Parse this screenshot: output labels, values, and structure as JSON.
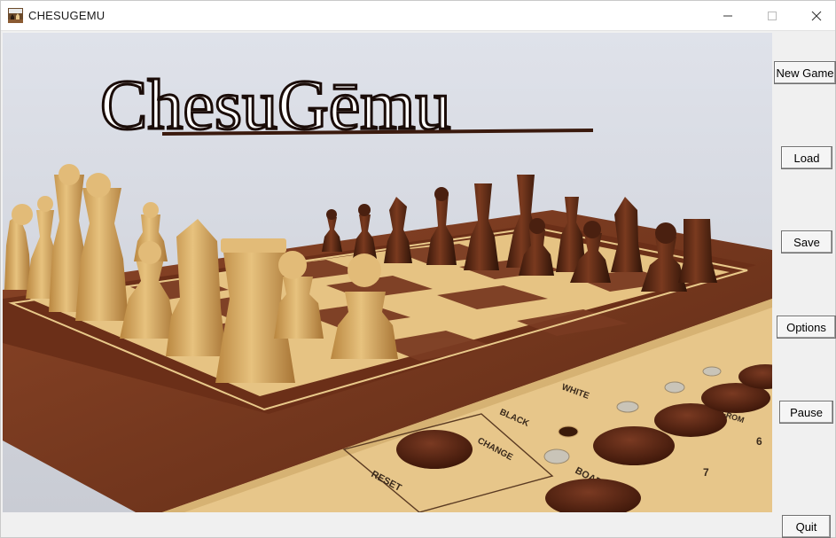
{
  "window": {
    "title": "CHESUGEMU",
    "app_icon": "chess-app-icon",
    "controls": {
      "minimize_icon": "minimize-icon",
      "maximize_icon": "maximize-icon",
      "close_icon": "close-icon"
    }
  },
  "banner": {
    "logo_text": "ChesuGēmu"
  },
  "board_panel": {
    "labels": {
      "reset": "RESET",
      "change": "CHANGE",
      "board": "BOARD",
      "black": "BLACK",
      "white": "WHITE",
      "from": "FROM",
      "num_6": "6",
      "num_7": "7"
    }
  },
  "sidebar": {
    "new_game": "New Game",
    "load": "Load",
    "save": "Save",
    "options": "Options",
    "pause": "Pause",
    "quit": "Quit"
  },
  "colors": {
    "background": "#f0f0f0",
    "titlebar": "#ffffff",
    "board_dark": "#7a3b22",
    "board_light": "#e9c98a",
    "light_piece": "#cfa25a",
    "dark_piece": "#5a2a17"
  }
}
